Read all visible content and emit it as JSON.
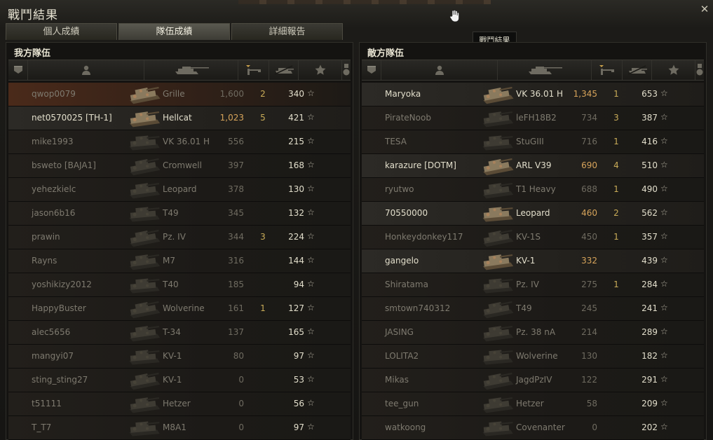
{
  "window": {
    "title": "戰鬥結果",
    "close_glyph": "✕",
    "cursor_icon": "hand-cursor-icon"
  },
  "tabs": [
    {
      "label": "個人成績",
      "active": false
    },
    {
      "label": "隊伍成績",
      "active": true
    },
    {
      "label": "詳細報告",
      "active": false
    }
  ],
  "tooltip": "戰鬥結果",
  "star_glyph": "☆",
  "allies": {
    "label": "我方隊伍",
    "players": [
      {
        "name": "qwop0079",
        "tank": "Grille",
        "damage": "1,600",
        "kills": "2",
        "xp": "340",
        "status": "self"
      },
      {
        "name": "net0570025 [TH-1]",
        "tank": "Hellcat",
        "damage": "1,023",
        "kills": "5",
        "xp": "421",
        "status": "alive"
      },
      {
        "name": "mike1993",
        "tank": "VK 36.01 H",
        "damage": "556",
        "kills": "",
        "xp": "215",
        "status": "dead"
      },
      {
        "name": "bsweto [BAJA1]",
        "tank": "Cromwell",
        "damage": "397",
        "kills": "",
        "xp": "168",
        "status": "dead"
      },
      {
        "name": "yehezkielc",
        "tank": "Leopard",
        "damage": "378",
        "kills": "",
        "xp": "130",
        "status": "dead"
      },
      {
        "name": "jason6b16",
        "tank": "T49",
        "damage": "345",
        "kills": "",
        "xp": "132",
        "status": "dead"
      },
      {
        "name": "prawin",
        "tank": "Pz. IV",
        "damage": "344",
        "kills": "3",
        "xp": "224",
        "status": "dead"
      },
      {
        "name": "Rayns",
        "tank": "M7",
        "damage": "316",
        "kills": "",
        "xp": "144",
        "status": "dead"
      },
      {
        "name": "yoshikizy2012",
        "tank": "T40",
        "damage": "185",
        "kills": "",
        "xp": "94",
        "status": "dead"
      },
      {
        "name": "HappyBuster",
        "tank": "Wolverine",
        "damage": "161",
        "kills": "1",
        "xp": "127",
        "status": "dead"
      },
      {
        "name": "alec5656",
        "tank": "T-34",
        "damage": "137",
        "kills": "",
        "xp": "165",
        "status": "dead"
      },
      {
        "name": "mangyi07",
        "tank": "KV-1",
        "damage": "80",
        "kills": "",
        "xp": "97",
        "status": "dead"
      },
      {
        "name": "sting_sting27",
        "tank": "KV-1",
        "damage": "0",
        "kills": "",
        "xp": "53",
        "status": "dead"
      },
      {
        "name": "t51111",
        "tank": "Hetzer",
        "damage": "0",
        "kills": "",
        "xp": "56",
        "status": "dead"
      },
      {
        "name": "T_T7",
        "tank": "M8A1",
        "damage": "0",
        "kills": "",
        "xp": "97",
        "status": "dead"
      }
    ]
  },
  "enemies": {
    "label": "敵方隊伍",
    "players": [
      {
        "name": "Maryoka",
        "tank": "VK 36.01 H",
        "damage": "1,345",
        "kills": "1",
        "xp": "653",
        "status": "alive"
      },
      {
        "name": "PirateNoob",
        "tank": "leFH18B2",
        "damage": "734",
        "kills": "3",
        "xp": "387",
        "status": "dead"
      },
      {
        "name": "TESA",
        "tank": "StuGIII",
        "damage": "716",
        "kills": "1",
        "xp": "416",
        "status": "dead"
      },
      {
        "name": "karazure [DOTM]",
        "tank": "ARL V39",
        "damage": "690",
        "kills": "4",
        "xp": "510",
        "status": "alive"
      },
      {
        "name": "ryutwo",
        "tank": "T1 Heavy",
        "damage": "688",
        "kills": "1",
        "xp": "490",
        "status": "dead"
      },
      {
        "name": "70550000",
        "tank": "Leopard",
        "damage": "460",
        "kills": "2",
        "xp": "562",
        "status": "alive"
      },
      {
        "name": "Honkeydonkey117",
        "tank": "KV-1S",
        "damage": "450",
        "kills": "1",
        "xp": "357",
        "status": "dead"
      },
      {
        "name": "gangelo",
        "tank": "KV-1",
        "damage": "332",
        "kills": "",
        "xp": "439",
        "status": "alive"
      },
      {
        "name": "Shiratama",
        "tank": "Pz. IV",
        "damage": "275",
        "kills": "1",
        "xp": "284",
        "status": "dead"
      },
      {
        "name": "smtown740312",
        "tank": "T49",
        "damage": "245",
        "kills": "",
        "xp": "241",
        "status": "dead"
      },
      {
        "name": "JASING",
        "tank": "Pz. 38 nA",
        "damage": "214",
        "kills": "",
        "xp": "289",
        "status": "dead"
      },
      {
        "name": "LOLITA2",
        "tank": "Wolverine",
        "damage": "130",
        "kills": "",
        "xp": "182",
        "status": "dead"
      },
      {
        "name": "Mikas",
        "tank": "JagdPzIV",
        "damage": "122",
        "kills": "",
        "xp": "291",
        "status": "dead"
      },
      {
        "name": "tee_gun",
        "tank": "Hetzer",
        "damage": "58",
        "kills": "",
        "xp": "209",
        "status": "dead"
      },
      {
        "name": "watkoong",
        "tank": "Covenanter",
        "damage": "0",
        "kills": "",
        "xp": "202",
        "status": "dead"
      }
    ]
  },
  "columns": {
    "icons": [
      "platoon-icon",
      "player-icon",
      "tank-icon",
      "damage-icon",
      "kills-icon",
      "xp-star-icon",
      "medal-icon"
    ]
  },
  "colors": {
    "alive_text": "#e2decb",
    "dead_text": "#7e7a6f",
    "damage_alive": "#d6a35a",
    "kills": "#c9ac58",
    "self_row": "#4a2a1a"
  }
}
